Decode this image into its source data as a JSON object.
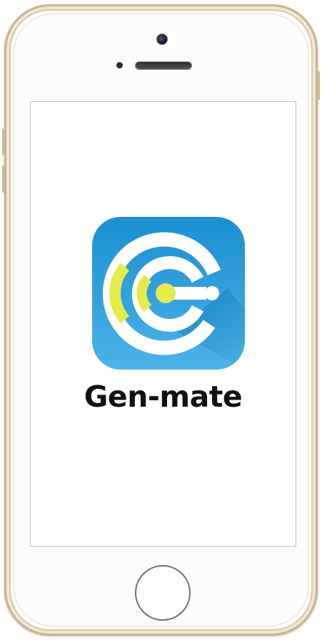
{
  "app": {
    "name": "Gen-mate",
    "icon": "gen-mate-logo-icon"
  },
  "device": {
    "frame_color": "#c9b48c",
    "body_color": "#fbfbfb"
  },
  "colors": {
    "icon_blue_top": "#1b8fd1",
    "icon_blue_bottom": "#4cb3e8",
    "accent_yellow": "#e4ec4b",
    "text": "#111111"
  }
}
